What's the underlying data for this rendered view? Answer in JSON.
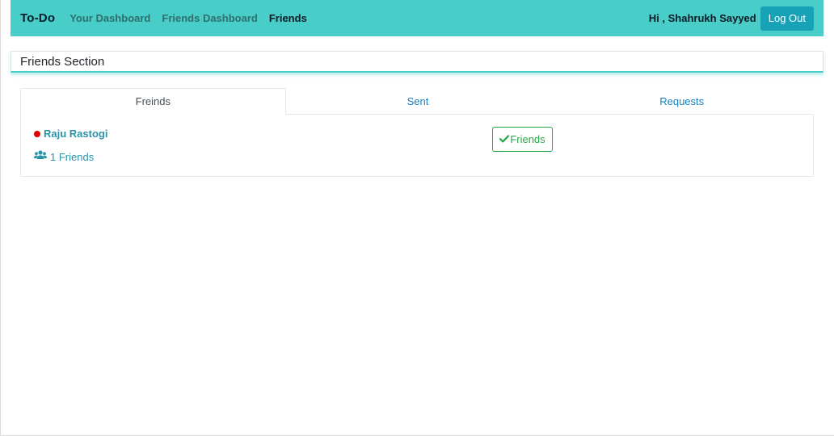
{
  "navbar": {
    "brand": "To-Do",
    "links": [
      "Your Dashboard",
      "Friends Dashboard",
      "Friends"
    ],
    "active_link": "Friends",
    "greeting": "Hi , Shahrukh Sayyed",
    "logout_label": "Log Out"
  },
  "section": {
    "title": "Friends Section"
  },
  "tabs": [
    {
      "label": "Freinds",
      "active": true
    },
    {
      "label": "Sent",
      "active": false
    },
    {
      "label": "Requests",
      "active": false
    }
  ],
  "friends": [
    {
      "name": "Raju Rastogi",
      "status_color": "#e00000",
      "friend_count": "1 Friends",
      "action_label": "Friends",
      "action_icon": "check-icon"
    }
  ],
  "colors": {
    "navbar_bg": "#48cdc9",
    "logout_bg": "#17a2b8",
    "link_color": "#1481c4",
    "success": "#28a745"
  }
}
